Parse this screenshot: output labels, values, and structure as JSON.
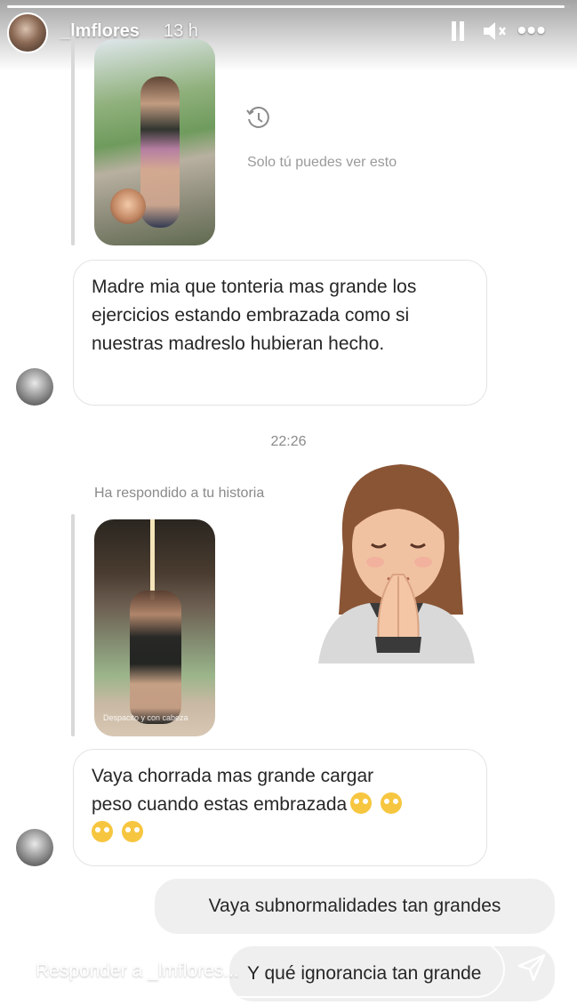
{
  "header": {
    "username": "_lmflores",
    "time_ago": "13 h",
    "story_progress": 0.99
  },
  "icons": {
    "pause": "pause-icon",
    "mute": "mute-icon",
    "more": "more-icon",
    "clock": "clock-icon",
    "send": "send-icon"
  },
  "messages": {
    "only_you": "Solo tú puedes ver esto",
    "msg1": "Madre mia que tonteria mas grande los ejercicios estando embrazada como si nuestras madreslo hubieran hecho.",
    "timestamp": "22:26",
    "replied_label": "Ha respondido a tu historia",
    "thumb2_caption": "Despacito y con cabeza",
    "msg2_line1": "Vaya chorrada mas grande cargar",
    "msg2_line2": "peso cuando estas embrazada",
    "sent1": "Vaya subnormalidades tan grandes",
    "sent2": "Y qué ignorancia tan grande"
  },
  "reply": {
    "placeholder": "Responder a _lmflores..."
  },
  "colors": {
    "bubble_border": "#e3e3e3",
    "sent_bg": "#efefef",
    "meta_text": "#8a8a8a"
  }
}
